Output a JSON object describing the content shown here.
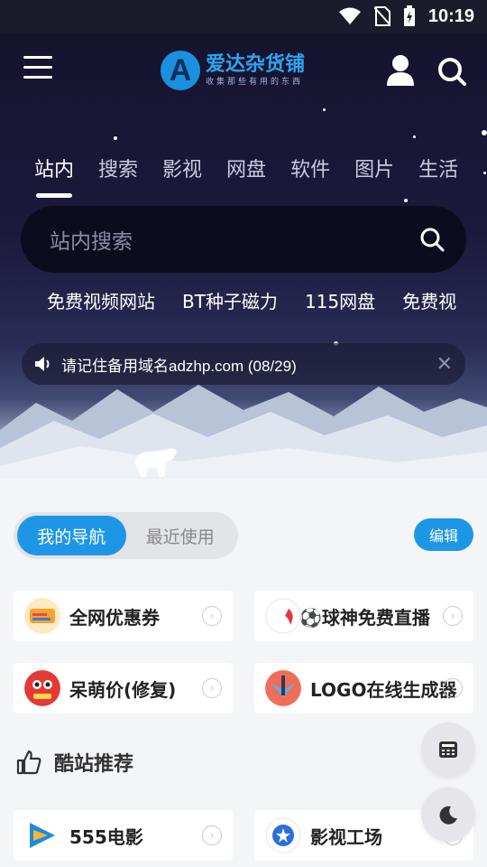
{
  "status": {
    "time": "10:19"
  },
  "header": {
    "logo_letter": "A",
    "logo_title": "爱达杂货铺",
    "logo_slogan": "收集那些有用的东西"
  },
  "tabs": [
    "站内",
    "搜索",
    "影视",
    "网盘",
    "软件",
    "图片",
    "生活"
  ],
  "search": {
    "placeholder": "站内搜索"
  },
  "hotwords": [
    "免费视频网站",
    "BT种子磁力",
    "115网盘",
    "免费视"
  ],
  "notice": {
    "text": "请记住备用域名adzhp.com (08/29)",
    "close": "✕"
  },
  "nav": {
    "my_nav": "我的导航",
    "recent": "最近使用",
    "edit": "编辑"
  },
  "cards": [
    {
      "label": "全网优惠券",
      "icon": "coupon-icon"
    },
    {
      "label": "⚽球神免费直播",
      "icon": "soccer-live-icon"
    },
    {
      "label": "呆萌价(修复)",
      "icon": "daimeng-icon"
    },
    {
      "label": "LOGO在线生成器",
      "icon": "logo-maker-icon"
    }
  ],
  "section": {
    "title": "酷站推荐"
  },
  "recommend": [
    {
      "label": "555电影",
      "icon": "movie-555-icon"
    },
    {
      "label": "影视工场",
      "icon": "film-factory-icon"
    }
  ]
}
